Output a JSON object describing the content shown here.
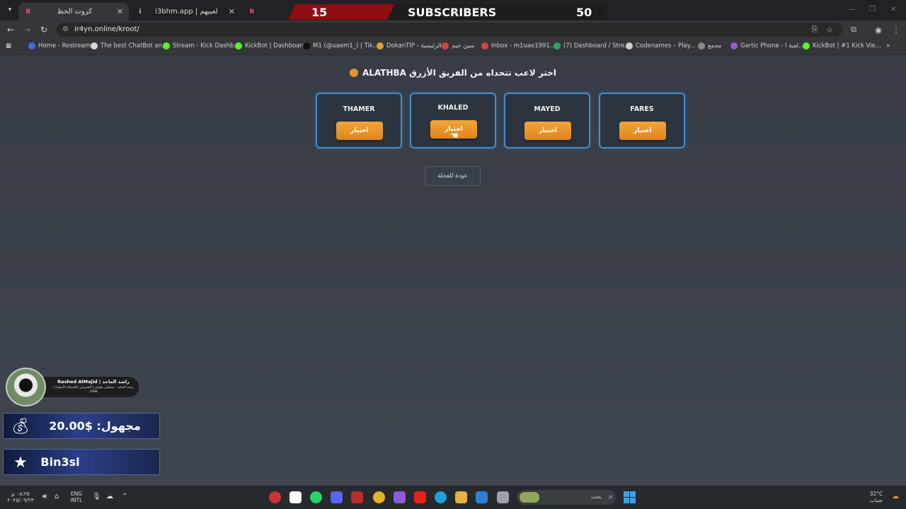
{
  "browser": {
    "tabs": [
      {
        "title": "كروت الحظ",
        "favicon": "R"
      },
      {
        "title": "i3bhm.app | لعبيهم",
        "favicon": "i"
      },
      {
        "title": "",
        "favicon": "R"
      }
    ],
    "url": "ir4yn.online/kroot/",
    "bookmarks": [
      {
        "label": "Home - Restream",
        "color": "#3b6fe0"
      },
      {
        "label": "The best ChatBot an...",
        "color": "#d8d8d8"
      },
      {
        "label": "Stream - Kick Dashb...",
        "color": "#53fc18"
      },
      {
        "label": "KickBot | Dashboard",
        "color": "#53fc18"
      },
      {
        "label": "M1 (@uaem1_) | Tik...",
        "color": "#111111"
      },
      {
        "label": "DokanTIP - الرئيسية",
        "color": "#e0a030"
      },
      {
        "label": "سين جيم",
        "color": "#d84040"
      },
      {
        "label": "Inbox - m1uae1991...",
        "color": "#d84040"
      },
      {
        "label": "(7) Dashboard / Stre...",
        "color": "#22aa66"
      },
      {
        "label": "Codenames – Play...",
        "color": "#cccccc"
      },
      {
        "label": "مجمع",
        "color": "#888888"
      },
      {
        "label": "Gartic Phone - لعبة ا...",
        "color": "#9b59d0"
      },
      {
        "label": "KickBot | #1 Kick Vie...",
        "color": "#53fc18"
      }
    ]
  },
  "overlay_top": {
    "left_value": "15",
    "label": "SUBSCRIBERS",
    "right_value": "50"
  },
  "page": {
    "heading": "ALATHBA اختر لاعب تتحداه من الفريق الأزرق",
    "players": [
      {
        "name": "THAMER",
        "button": "اختيار"
      },
      {
        "name": "KHALED",
        "button": "اختيار"
      },
      {
        "name": "MAYED",
        "button": "اختيار"
      },
      {
        "name": "FARES",
        "button": "اختيار"
      }
    ],
    "back_button": "عودة للعجلة"
  },
  "stream_overlay": {
    "profile_name": "Rashed AlMajid | راشد الماجد",
    "profile_bio": "راشد الماجد - يشكيلي ظبيانو يا الحجراني (الشمالة الأصلية) | 1998",
    "donation": "مجهول: $20.00",
    "follower": "Bin3sl"
  },
  "taskbar": {
    "time": "٠٨:٢٥ م",
    "date": "٢٠٢٥/٠٩/٢٣",
    "lang_top": "ENG",
    "lang_bottom": "INTL",
    "search_label": "بحث",
    "weather_temp": "32°C",
    "weather_desc": "ضباب"
  },
  "colors": {
    "card_border": "#3f8fd4",
    "button_orange": "#e9932b",
    "subscribers_red": "#8f0d11"
  }
}
